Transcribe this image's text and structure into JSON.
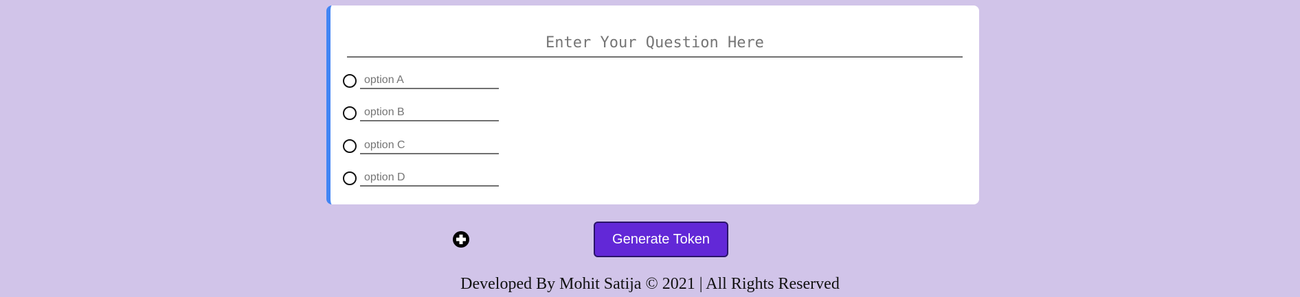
{
  "question": {
    "placeholder": "Enter Your Question Here",
    "value": ""
  },
  "options": [
    {
      "placeholder": "option A",
      "value": ""
    },
    {
      "placeholder": "option B",
      "value": ""
    },
    {
      "placeholder": "option C",
      "value": ""
    },
    {
      "placeholder": "option D",
      "value": ""
    }
  ],
  "add_option_icon": "plus-circle-icon",
  "generate_button": {
    "label": "Generate Token"
  },
  "footer": {
    "text": "Developed By Mohit Satija © 2021 | All Rights Reserved"
  },
  "colors": {
    "background": "#d1c4e9",
    "card_accent": "#4285f4",
    "button": "#6228d7"
  }
}
